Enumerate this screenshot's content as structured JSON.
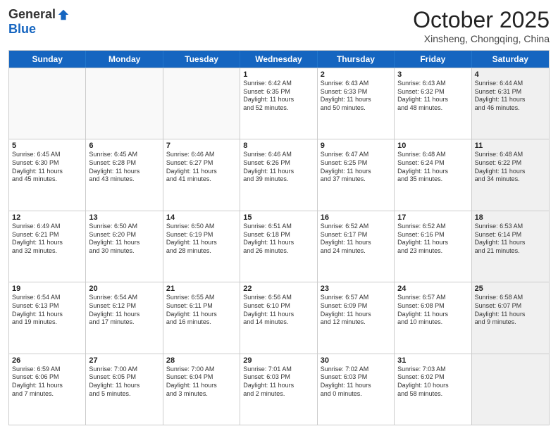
{
  "logo": {
    "general": "General",
    "blue": "Blue"
  },
  "title": "October 2025",
  "subtitle": "Xinsheng, Chongqing, China",
  "headers": [
    "Sunday",
    "Monday",
    "Tuesday",
    "Wednesday",
    "Thursday",
    "Friday",
    "Saturday"
  ],
  "rows": [
    [
      {
        "day": "",
        "text": "",
        "empty": true
      },
      {
        "day": "",
        "text": "",
        "empty": true
      },
      {
        "day": "",
        "text": "",
        "empty": true
      },
      {
        "day": "1",
        "text": "Sunrise: 6:42 AM\nSunset: 6:35 PM\nDaylight: 11 hours\nand 52 minutes.",
        "empty": false
      },
      {
        "day": "2",
        "text": "Sunrise: 6:43 AM\nSunset: 6:33 PM\nDaylight: 11 hours\nand 50 minutes.",
        "empty": false
      },
      {
        "day": "3",
        "text": "Sunrise: 6:43 AM\nSunset: 6:32 PM\nDaylight: 11 hours\nand 48 minutes.",
        "empty": false
      },
      {
        "day": "4",
        "text": "Sunrise: 6:44 AM\nSunset: 6:31 PM\nDaylight: 11 hours\nand 46 minutes.",
        "empty": false,
        "shaded": true
      }
    ],
    [
      {
        "day": "5",
        "text": "Sunrise: 6:45 AM\nSunset: 6:30 PM\nDaylight: 11 hours\nand 45 minutes.",
        "empty": false
      },
      {
        "day": "6",
        "text": "Sunrise: 6:45 AM\nSunset: 6:28 PM\nDaylight: 11 hours\nand 43 minutes.",
        "empty": false
      },
      {
        "day": "7",
        "text": "Sunrise: 6:46 AM\nSunset: 6:27 PM\nDaylight: 11 hours\nand 41 minutes.",
        "empty": false
      },
      {
        "day": "8",
        "text": "Sunrise: 6:46 AM\nSunset: 6:26 PM\nDaylight: 11 hours\nand 39 minutes.",
        "empty": false
      },
      {
        "day": "9",
        "text": "Sunrise: 6:47 AM\nSunset: 6:25 PM\nDaylight: 11 hours\nand 37 minutes.",
        "empty": false
      },
      {
        "day": "10",
        "text": "Sunrise: 6:48 AM\nSunset: 6:24 PM\nDaylight: 11 hours\nand 35 minutes.",
        "empty": false
      },
      {
        "day": "11",
        "text": "Sunrise: 6:48 AM\nSunset: 6:22 PM\nDaylight: 11 hours\nand 34 minutes.",
        "empty": false,
        "shaded": true
      }
    ],
    [
      {
        "day": "12",
        "text": "Sunrise: 6:49 AM\nSunset: 6:21 PM\nDaylight: 11 hours\nand 32 minutes.",
        "empty": false
      },
      {
        "day": "13",
        "text": "Sunrise: 6:50 AM\nSunset: 6:20 PM\nDaylight: 11 hours\nand 30 minutes.",
        "empty": false
      },
      {
        "day": "14",
        "text": "Sunrise: 6:50 AM\nSunset: 6:19 PM\nDaylight: 11 hours\nand 28 minutes.",
        "empty": false
      },
      {
        "day": "15",
        "text": "Sunrise: 6:51 AM\nSunset: 6:18 PM\nDaylight: 11 hours\nand 26 minutes.",
        "empty": false
      },
      {
        "day": "16",
        "text": "Sunrise: 6:52 AM\nSunset: 6:17 PM\nDaylight: 11 hours\nand 24 minutes.",
        "empty": false
      },
      {
        "day": "17",
        "text": "Sunrise: 6:52 AM\nSunset: 6:16 PM\nDaylight: 11 hours\nand 23 minutes.",
        "empty": false
      },
      {
        "day": "18",
        "text": "Sunrise: 6:53 AM\nSunset: 6:14 PM\nDaylight: 11 hours\nand 21 minutes.",
        "empty": false,
        "shaded": true
      }
    ],
    [
      {
        "day": "19",
        "text": "Sunrise: 6:54 AM\nSunset: 6:13 PM\nDaylight: 11 hours\nand 19 minutes.",
        "empty": false
      },
      {
        "day": "20",
        "text": "Sunrise: 6:54 AM\nSunset: 6:12 PM\nDaylight: 11 hours\nand 17 minutes.",
        "empty": false
      },
      {
        "day": "21",
        "text": "Sunrise: 6:55 AM\nSunset: 6:11 PM\nDaylight: 11 hours\nand 16 minutes.",
        "empty": false
      },
      {
        "day": "22",
        "text": "Sunrise: 6:56 AM\nSunset: 6:10 PM\nDaylight: 11 hours\nand 14 minutes.",
        "empty": false
      },
      {
        "day": "23",
        "text": "Sunrise: 6:57 AM\nSunset: 6:09 PM\nDaylight: 11 hours\nand 12 minutes.",
        "empty": false
      },
      {
        "day": "24",
        "text": "Sunrise: 6:57 AM\nSunset: 6:08 PM\nDaylight: 11 hours\nand 10 minutes.",
        "empty": false
      },
      {
        "day": "25",
        "text": "Sunrise: 6:58 AM\nSunset: 6:07 PM\nDaylight: 11 hours\nand 9 minutes.",
        "empty": false,
        "shaded": true
      }
    ],
    [
      {
        "day": "26",
        "text": "Sunrise: 6:59 AM\nSunset: 6:06 PM\nDaylight: 11 hours\nand 7 minutes.",
        "empty": false
      },
      {
        "day": "27",
        "text": "Sunrise: 7:00 AM\nSunset: 6:05 PM\nDaylight: 11 hours\nand 5 minutes.",
        "empty": false
      },
      {
        "day": "28",
        "text": "Sunrise: 7:00 AM\nSunset: 6:04 PM\nDaylight: 11 hours\nand 3 minutes.",
        "empty": false
      },
      {
        "day": "29",
        "text": "Sunrise: 7:01 AM\nSunset: 6:03 PM\nDaylight: 11 hours\nand 2 minutes.",
        "empty": false
      },
      {
        "day": "30",
        "text": "Sunrise: 7:02 AM\nSunset: 6:03 PM\nDaylight: 11 hours\nand 0 minutes.",
        "empty": false
      },
      {
        "day": "31",
        "text": "Sunrise: 7:03 AM\nSunset: 6:02 PM\nDaylight: 10 hours\nand 58 minutes.",
        "empty": false
      },
      {
        "day": "",
        "text": "",
        "empty": true,
        "shaded": true
      }
    ]
  ]
}
